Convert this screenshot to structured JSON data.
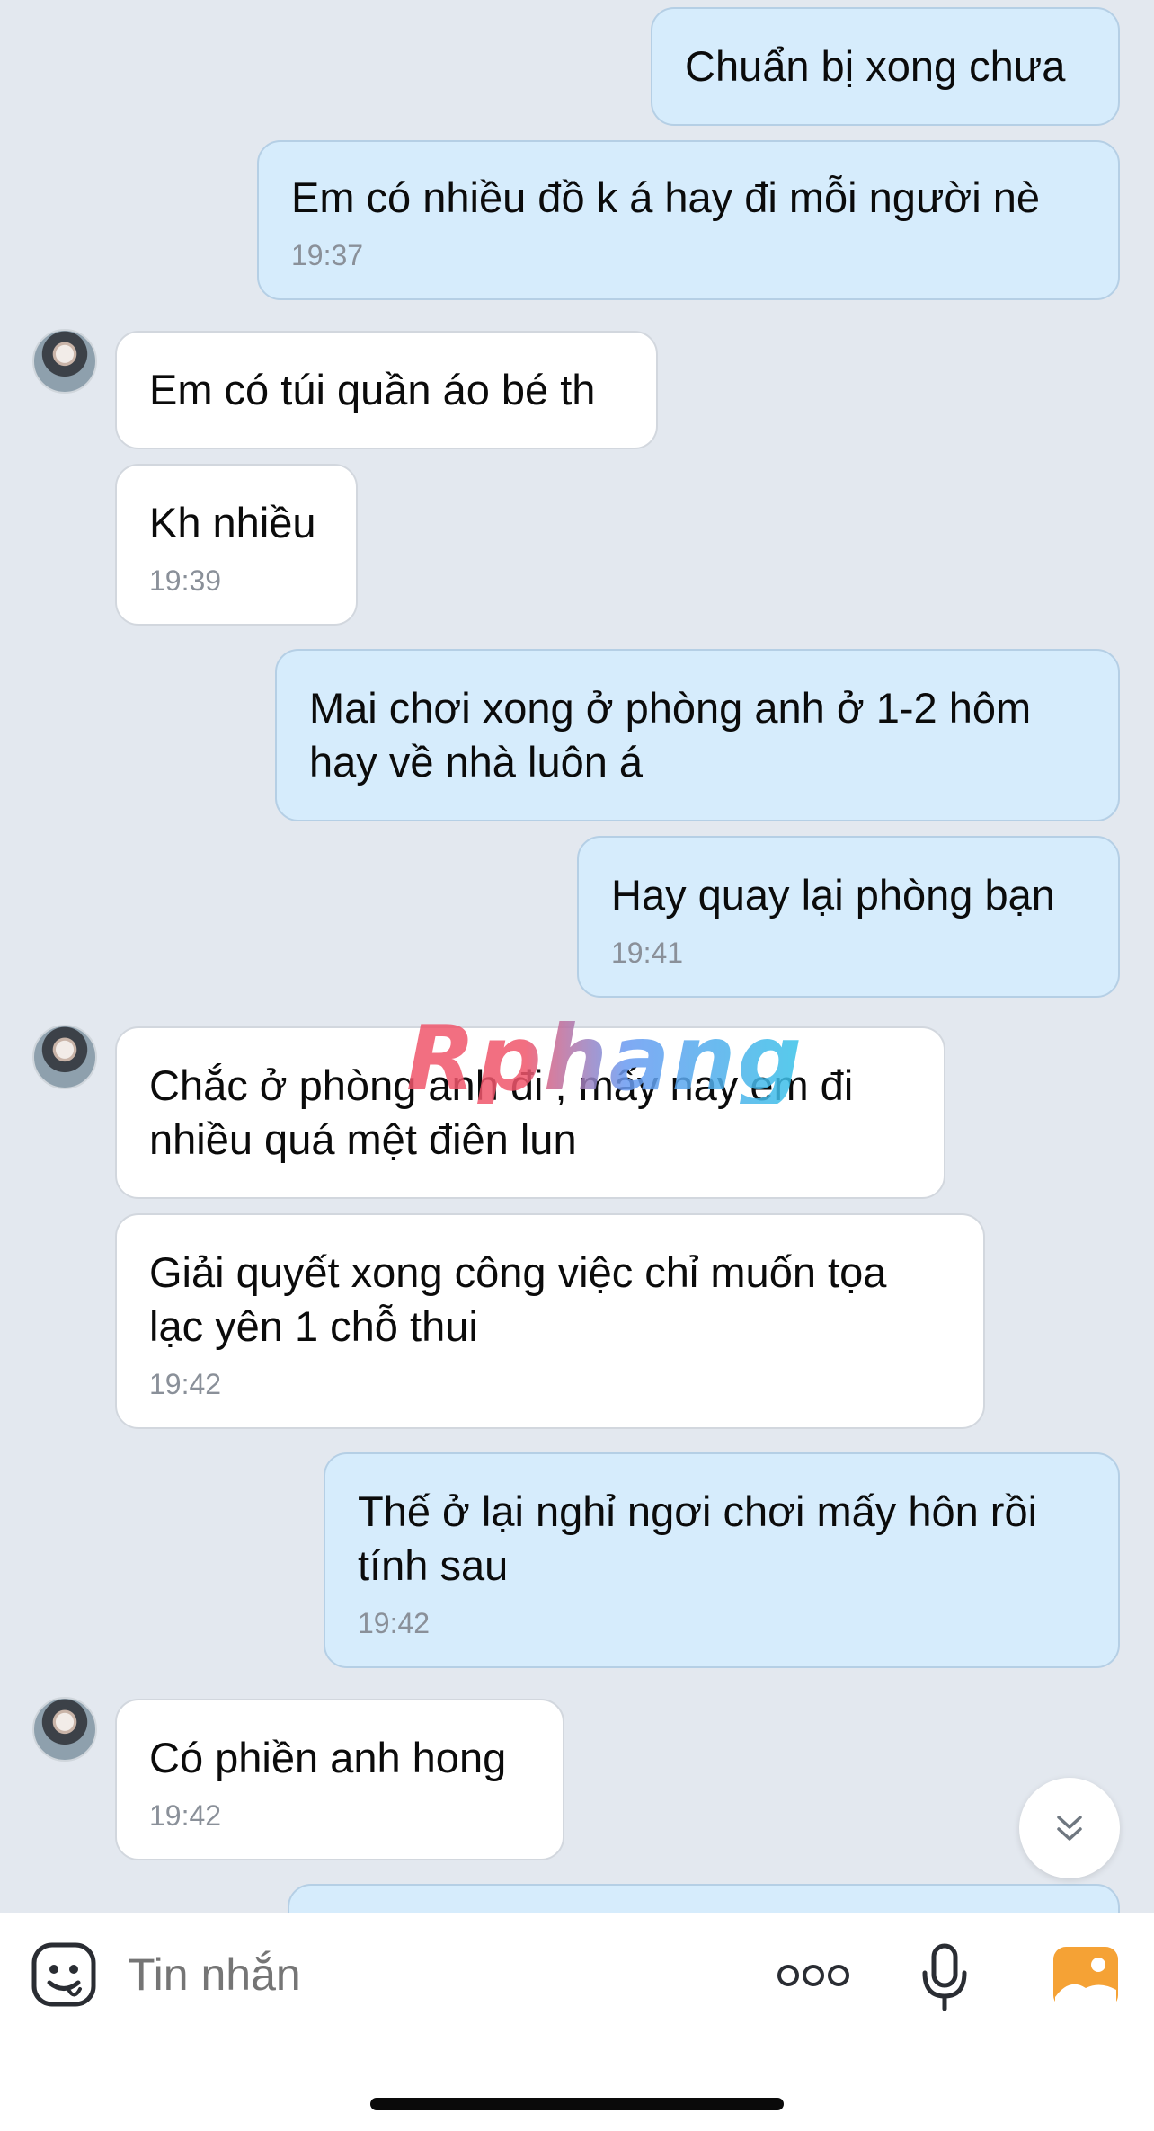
{
  "messages": [
    {
      "dir": "out",
      "text": "Chuẩn bị xong chưa",
      "time": ""
    },
    {
      "dir": "out",
      "text": "Em có nhiều đồ k á hay đi mỗi người nè",
      "time": "19:37"
    },
    {
      "dir": "in",
      "text": "Em có túi quần áo bé th",
      "time": ""
    },
    {
      "dir": "in",
      "text": "Kh nhiều",
      "time": "19:39"
    },
    {
      "dir": "out",
      "text": "Mai chơi xong ở phòng anh ở 1-2 hôm\nhay về nhà luôn á",
      "time": ""
    },
    {
      "dir": "out",
      "text": "Hay quay lại phòng bạn",
      "time": "19:41"
    },
    {
      "dir": "in",
      "text": "Chắc ở phòng anh đi , mấy nay em đi\nnhiều quá mệt điên lun",
      "time": ""
    },
    {
      "dir": "in",
      "text": "Giải quyết xong công việc chỉ muốn tọa\nlạc yên 1 chỗ thui",
      "time": "19:42"
    },
    {
      "dir": "out",
      "text": "Thế ở lại nghỉ ngơi chơi mấy hôn rồi\ntính sau",
      "time": "19:42"
    },
    {
      "dir": "in",
      "text": "Có phiền anh hong",
      "time": "19:42"
    }
  ],
  "watermark": "Rphang",
  "input": {
    "placeholder": "Tin nhắn"
  },
  "icons": {
    "sticker": "sticker-smile-icon",
    "more": "more-dots-icon",
    "mic": "microphone-icon",
    "gallery": "gallery-image-icon",
    "scroll": "scroll-down-chevron-icon"
  },
  "colors": {
    "background": "#e3e8ef",
    "outgoing_bubble": "#d6ecfc",
    "incoming_bubble": "#ffffff",
    "gallery_icon": "#f5a235"
  }
}
